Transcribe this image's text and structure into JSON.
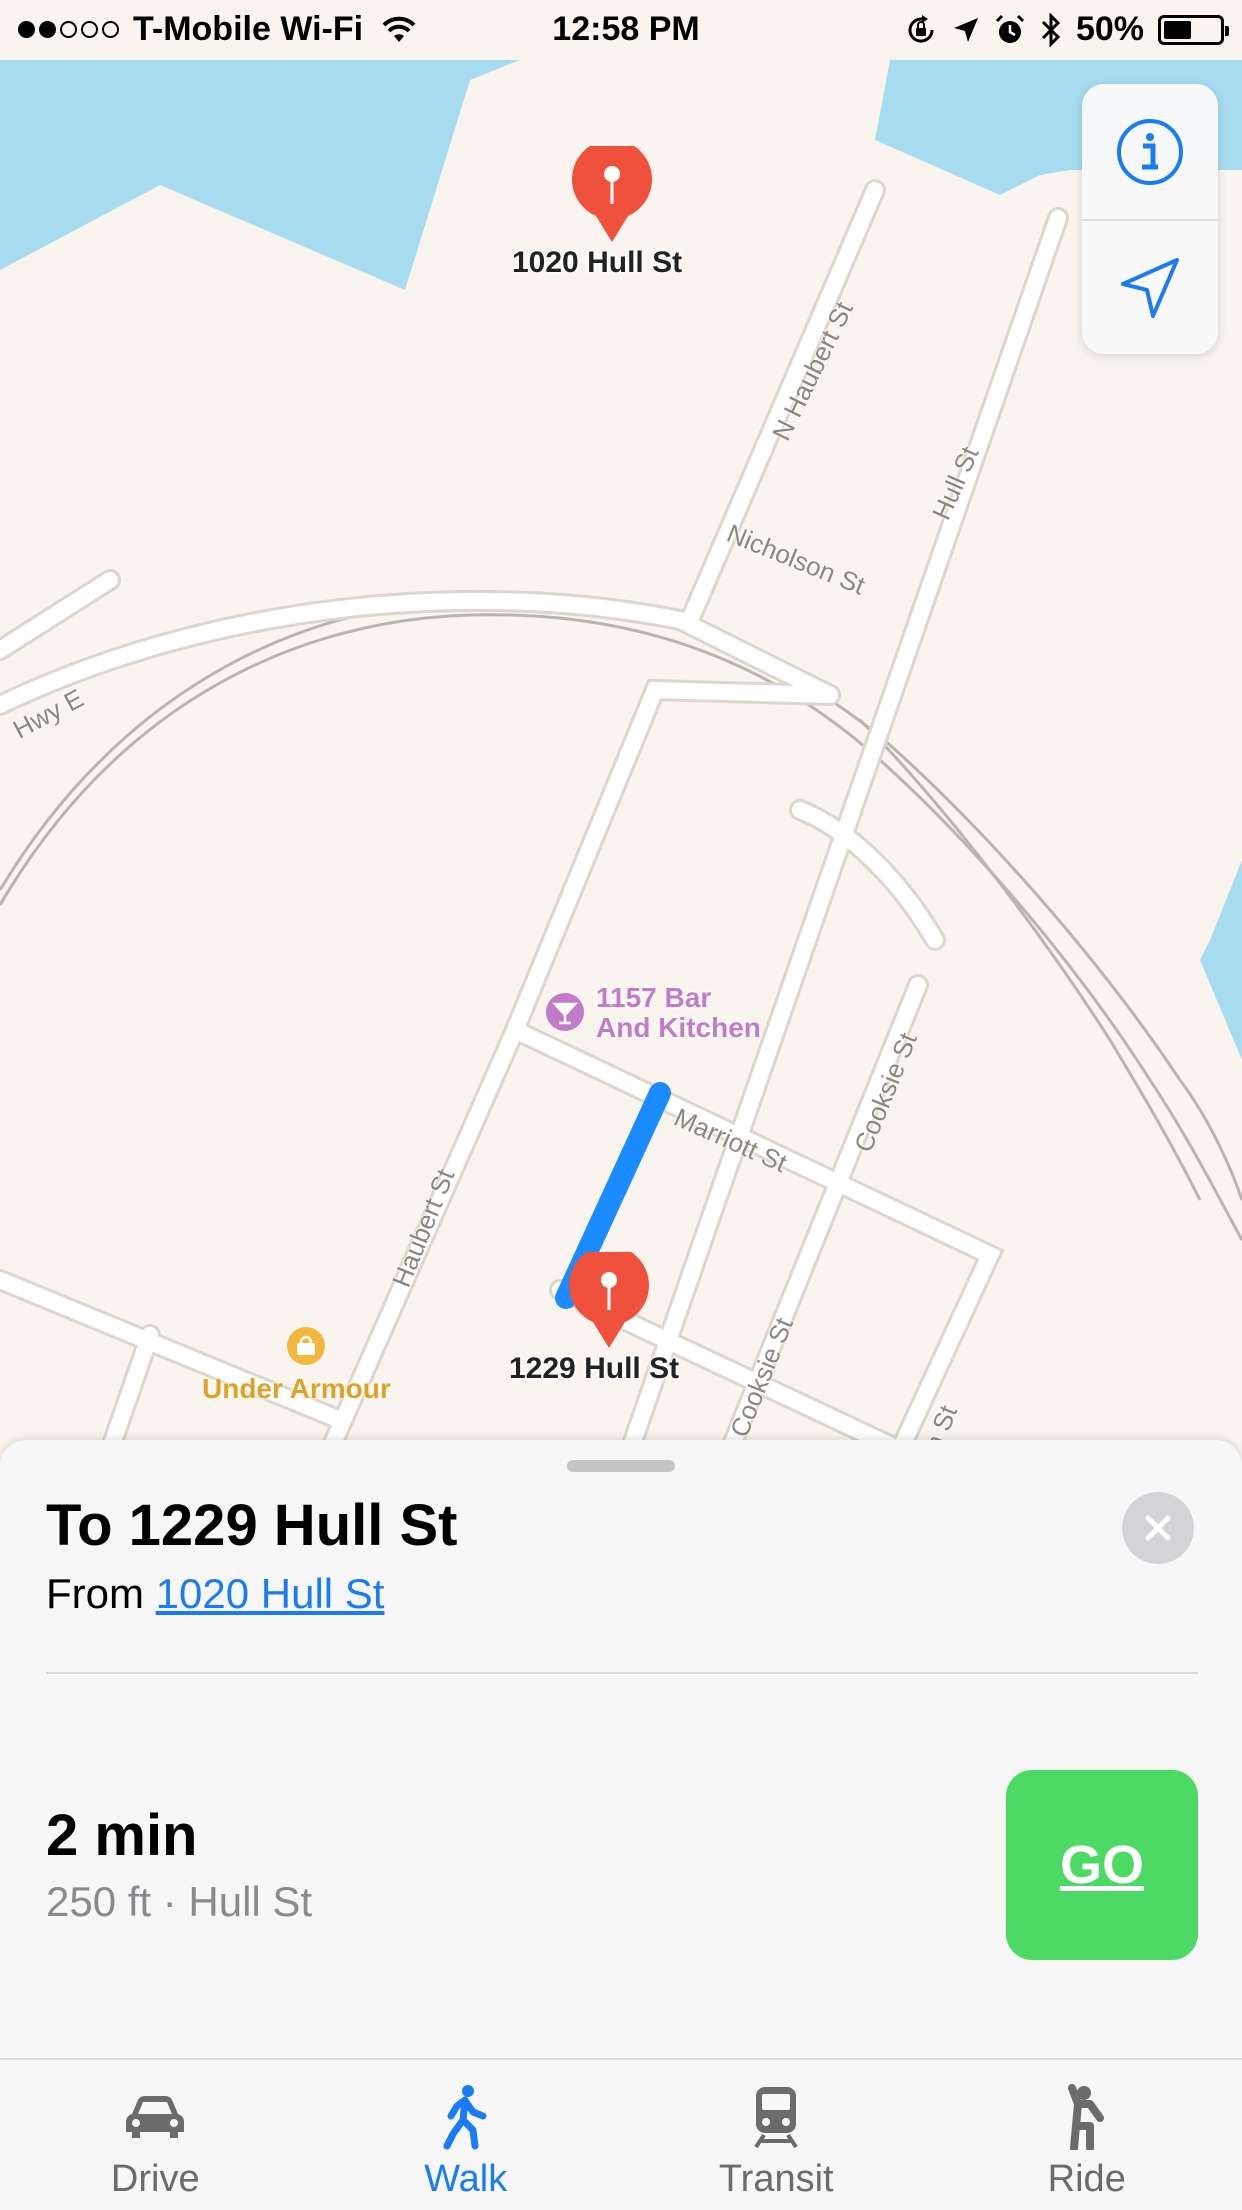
{
  "status_bar": {
    "carrier": "T-Mobile Wi-Fi",
    "time": "12:58 PM",
    "battery_percent": "50%",
    "battery_level": 0.5,
    "signal_bars_filled": 2,
    "signal_bars_total": 5,
    "icons": [
      "wifi-icon",
      "rotation-lock-icon",
      "location-arrow-icon",
      "alarm-icon",
      "bluetooth-icon",
      "battery-icon"
    ]
  },
  "map": {
    "street_labels": [
      "N Haubert St",
      "Hull St",
      "Nicholson St",
      "Hwy E",
      "Marriott St",
      "Cooksie St",
      "Haubert St",
      "Cooksie St",
      "n St"
    ],
    "pins": {
      "origin": "1020 Hull St",
      "destination": "1229 Hull St"
    },
    "pois": {
      "bar": "1157 Bar\nAnd Kitchen",
      "store": "Under Armour"
    },
    "colors": {
      "land": "#f9f5ee",
      "water": "#a7dcf0",
      "road": "#ffffff",
      "route": "#1a8cff",
      "pin": "#f0513c",
      "bar_poi": "#c27bc8",
      "store_poi": "#e0a128"
    }
  },
  "map_controls": {
    "info_icon": "info-icon",
    "location_icon": "location-arrow-icon"
  },
  "directions": {
    "title": "To 1229 Hull St",
    "from_prefix": "From",
    "from_link": "1020 Hull St",
    "eta": "2 min",
    "detail": "250 ft · Hull St",
    "go_label": "GO"
  },
  "tabs": [
    {
      "label": "Drive",
      "icon": "car-icon",
      "active": false
    },
    {
      "label": "Walk",
      "icon": "walk-icon",
      "active": true
    },
    {
      "label": "Transit",
      "icon": "train-icon",
      "active": false
    },
    {
      "label": "Ride",
      "icon": "ride-icon",
      "active": false
    }
  ],
  "colors": {
    "accent": "#1a7cf5",
    "go_button": "#4cd964"
  }
}
